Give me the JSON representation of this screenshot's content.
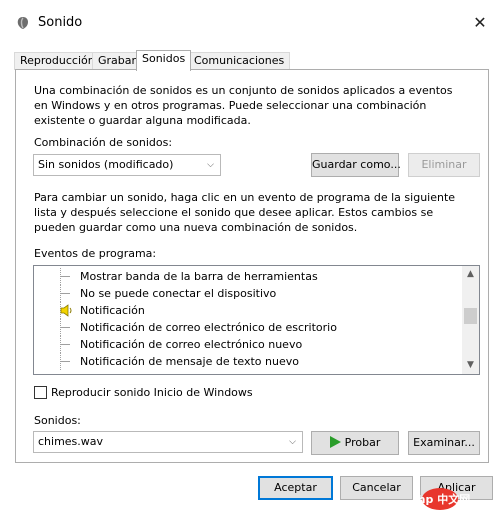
{
  "window": {
    "title": "Sonido",
    "close_glyph": "✕",
    "icon": "speaker-app-icon"
  },
  "tabs": [
    {
      "label": "Reproducción",
      "active": false
    },
    {
      "label": "Grabar",
      "active": false
    },
    {
      "label": "Sonidos",
      "active": true
    },
    {
      "label": "Comunicaciones",
      "active": false
    }
  ],
  "intro_text": "Una combinación de sonidos es un conjunto de sonidos aplicados a eventos en Windows y en otros programas. Puede seleccionar una combinación existente o guardar alguna modificada.",
  "scheme": {
    "label": "Combinación de sonidos:",
    "selected": "Sin sonidos (modificado)",
    "save_label": "Guardar como...",
    "delete_label": "Eliminar"
  },
  "instructions_text": "Para cambiar un sonido, haga clic en un evento de programa de la siguiente lista y después seleccione el sonido que desee aplicar. Estos cambios se pueden guardar como una nueva combinación de sonidos.",
  "events": {
    "label": "Eventos de programa:",
    "items": [
      {
        "label": "Mostrar banda de la barra de herramientas",
        "has_sound": false
      },
      {
        "label": "No se puede conectar el dispositivo",
        "has_sound": false
      },
      {
        "label": "Notificación",
        "has_sound": true,
        "selected": true
      },
      {
        "label": "Notificación de correo electrónico de escritorio",
        "has_sound": false
      },
      {
        "label": "Notificación de correo electrónico nuevo",
        "has_sound": false
      },
      {
        "label": "Notificación de mensaje de texto nuevo",
        "has_sound": false
      }
    ]
  },
  "startup": {
    "label": "Reproducir sonido Inicio de Windows",
    "checked": false
  },
  "sounds": {
    "label": "Sonidos:",
    "selected": "chimes.wav",
    "test_label": "Probar",
    "browse_label": "Examinar..."
  },
  "footer": {
    "ok_label": "Aceptar",
    "cancel_label": "Cancelar",
    "apply_label": "Aplicar"
  },
  "watermark": {
    "text": "php 中文网"
  },
  "colors": {
    "accent": "#0078d7",
    "play_green": "#2a9d2a",
    "speaker_yellow": "#f2d300",
    "watermark_red": "#e8362d"
  }
}
